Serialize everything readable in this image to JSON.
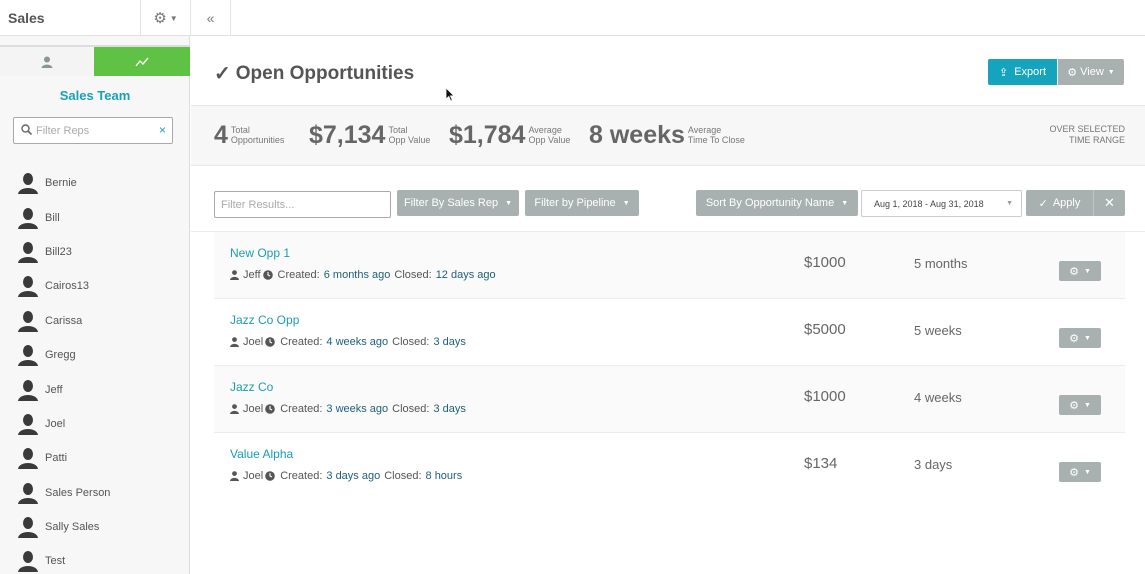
{
  "app": {
    "title": "Sales"
  },
  "sidebar": {
    "team_title": "Sales Team",
    "filter_placeholder": "Filter Reps",
    "clear_symbol": "×",
    "reps": [
      "Bernie",
      "Bill",
      "Bill23",
      "Cairos13",
      "Carissa",
      "Gregg",
      "Jeff",
      "Joel",
      "Patti",
      "Sales Person",
      "Sally Sales",
      "Test"
    ]
  },
  "header": {
    "title": "Open Opportunities",
    "export_label": "Export",
    "view_label": "View"
  },
  "stats": {
    "total_opps": {
      "value": "4",
      "label_1": "Total",
      "label_2": "Opportunities"
    },
    "total_value": {
      "value": "$7,134",
      "label_1": "Total",
      "label_2": "Opp Value"
    },
    "avg_value": {
      "value": "$1,784",
      "label_1": "Average",
      "label_2": "Opp Value"
    },
    "avg_time": {
      "value": "8 weeks",
      "label_1": "Average",
      "label_2": "Time To Close"
    },
    "range_line_1": "OVER SELECTED",
    "range_line_2": "TIME RANGE"
  },
  "filters": {
    "results_placeholder": "Filter Results...",
    "sales_rep_label": "Filter By Sales Rep",
    "pipeline_label": "Filter by Pipeline",
    "sort_label": "Sort By Opportunity Name",
    "date_range": "Aug 1, 2018 - Aug 31, 2018",
    "apply_label": "Apply",
    "clear_symbol": "✕"
  },
  "opportunities": [
    {
      "name": "New Opp 1",
      "rep": "Jeff",
      "created_label": "Created:",
      "created": "6 months ago",
      "closed_label": "Closed:",
      "closed": "12 days ago",
      "amount": "$1000",
      "time": "5 months"
    },
    {
      "name": "Jazz Co Opp",
      "rep": "Joel",
      "created_label": "Created:",
      "created": "4 weeks ago",
      "closed_label": "Closed:",
      "closed": "3 days",
      "amount": "$5000",
      "time": "5 weeks"
    },
    {
      "name": "Jazz Co",
      "rep": "Joel",
      "created_label": "Created:",
      "created": "3 weeks ago",
      "closed_label": "Closed:",
      "closed": "3 days",
      "amount": "$1000",
      "time": "4 weeks"
    },
    {
      "name": "Value Alpha",
      "rep": "Joel",
      "created_label": "Created:",
      "created": "3 days ago",
      "closed_label": "Closed:",
      "closed": "8 hours",
      "amount": "$134",
      "time": "3 days"
    }
  ],
  "colors": {
    "accent": "#1aa0b8",
    "chart_tab": "#5fc244",
    "export": "#16a3bd",
    "gray_button": "#a9b0b0"
  }
}
